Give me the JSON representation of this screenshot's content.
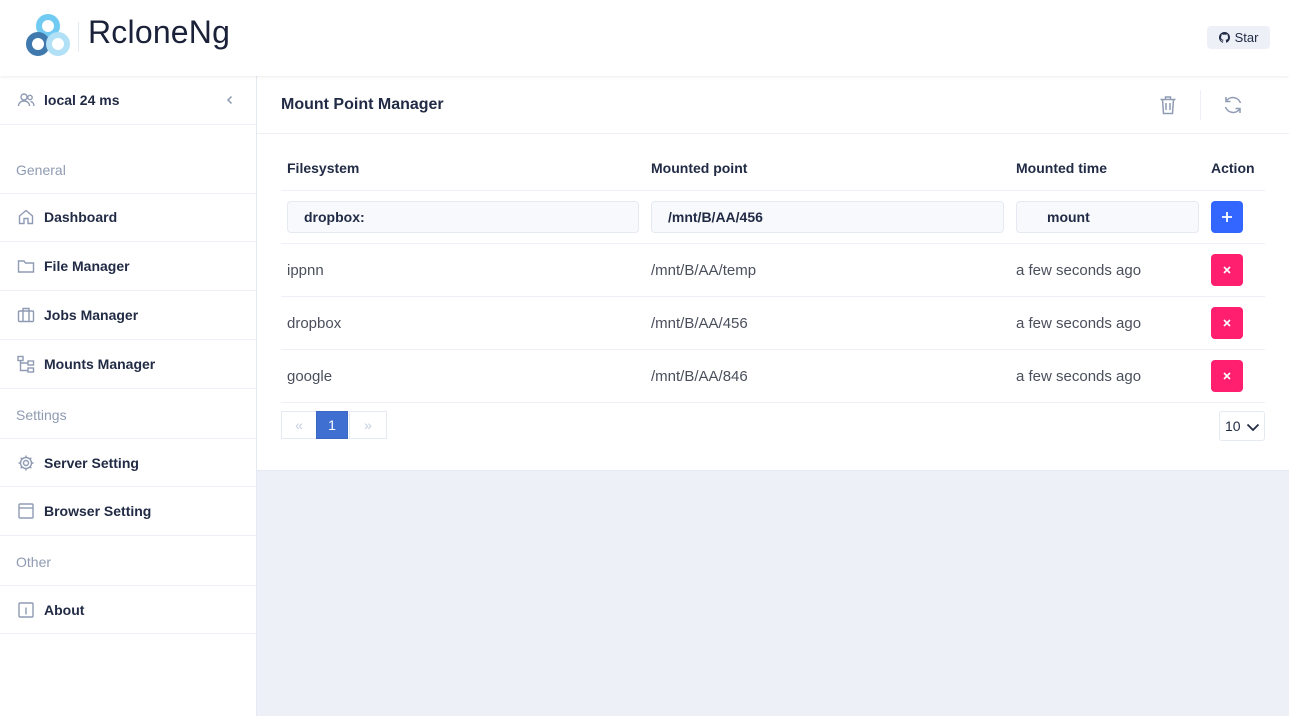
{
  "app": {
    "title": "RcloneNg",
    "star_label": "Star"
  },
  "sidebar": {
    "server_label": "local 24 ms",
    "groups": {
      "general": "General",
      "settings": "Settings",
      "other": "Other"
    },
    "items": [
      {
        "label": "Dashboard",
        "icon": "home-icon"
      },
      {
        "label": "File Manager",
        "icon": "folder-icon"
      },
      {
        "label": "Jobs Manager",
        "icon": "briefcase-icon"
      },
      {
        "label": "Mounts Manager",
        "icon": "tree-icon"
      },
      {
        "label": "Server Setting",
        "icon": "gear-icon"
      },
      {
        "label": "Browser Setting",
        "icon": "browser-icon"
      },
      {
        "label": "About",
        "icon": "info-icon"
      }
    ]
  },
  "main": {
    "title": "Mount Point Manager",
    "table": {
      "headers": {
        "filesystem": "Filesystem",
        "mounted_point": "Mounted point",
        "mounted_time": "Mounted time",
        "action": "Action"
      },
      "new_row": {
        "filesystem": "dropbox:",
        "mounted_point": "/mnt/B/AA/456",
        "mount_label": "mount"
      },
      "rows": [
        {
          "filesystem": "ippnn",
          "mounted_point": "/mnt/B/AA/temp",
          "mounted_time": "a few seconds ago"
        },
        {
          "filesystem": "dropbox",
          "mounted_point": "/mnt/B/AA/456",
          "mounted_time": "a few seconds ago"
        },
        {
          "filesystem": "google",
          "mounted_point": "/mnt/B/AA/846",
          "mounted_time": "a few seconds ago"
        }
      ]
    },
    "pagination": {
      "prev": "«",
      "current": "1",
      "next": "»",
      "page_size": "10"
    }
  },
  "colors": {
    "primary": "#3366ff",
    "danger": "#ff1f6e",
    "page_active": "#3f70d1"
  }
}
